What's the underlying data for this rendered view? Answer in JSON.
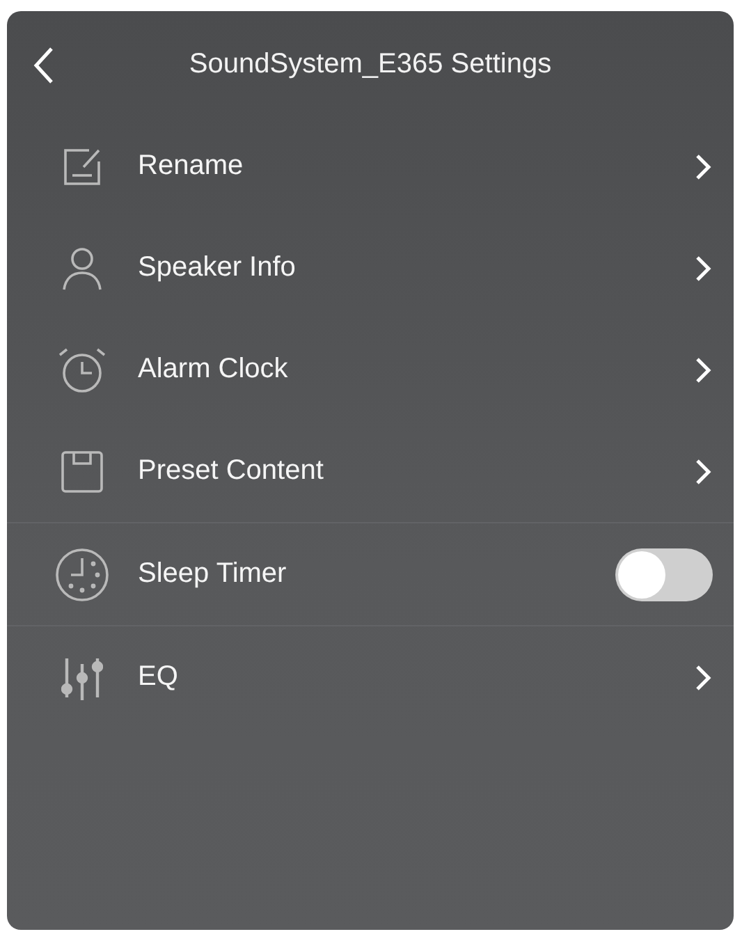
{
  "header": {
    "title": "SoundSystem_E365 Settings"
  },
  "items": [
    {
      "kind": "link",
      "label": "Rename"
    },
    {
      "kind": "link",
      "label": "Speaker Info"
    },
    {
      "kind": "link",
      "label": "Alarm Clock"
    },
    {
      "kind": "link",
      "label": "Preset Content"
    },
    {
      "kind": "toggle",
      "label": "Sleep Timer",
      "on": false
    },
    {
      "kind": "link",
      "label": "EQ"
    }
  ]
}
